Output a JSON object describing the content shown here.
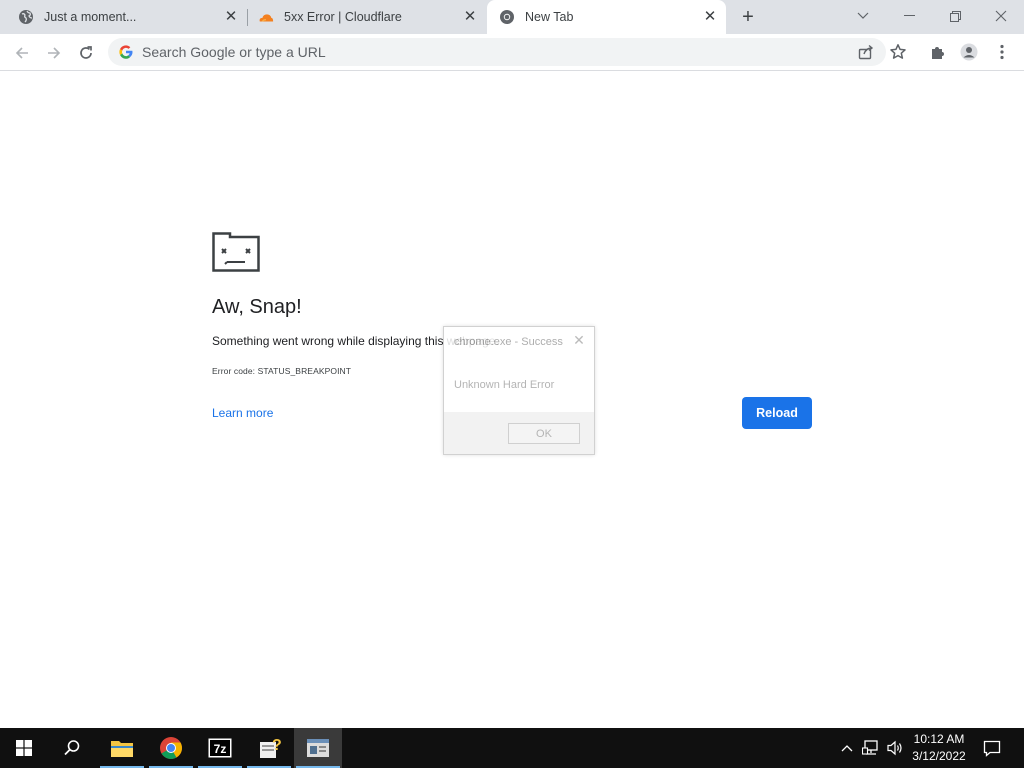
{
  "browser": {
    "tabs": [
      {
        "title": "Just a moment...",
        "favicon": "globe-icon",
        "active": false
      },
      {
        "title": "5xx Error | Cloudflare",
        "favicon": "cloudflare-icon",
        "active": false
      },
      {
        "title": "New Tab",
        "favicon": "chrome-icon",
        "active": true
      }
    ],
    "new_tab_symbol": "+",
    "omnibox_placeholder": "Search Google or type a URL"
  },
  "page": {
    "heading": "Aw, Snap!",
    "message": "Something went wrong while displaying this webpage.",
    "error_code": "Error code: STATUS_BREAKPOINT",
    "learn_more": "Learn more",
    "reload_label": "Reload"
  },
  "dialog": {
    "title": "chrome.exe - Success",
    "body": "Unknown Hard Error",
    "ok_label": "OK"
  },
  "taskbar": {
    "apps": [
      "start-icon",
      "search-icon",
      "file-explorer-icon",
      "chrome-icon",
      "7zip-icon",
      "help-app-icon",
      "error-dialog-app-icon"
    ],
    "time": "10:12 AM",
    "date": "3/12/2022"
  },
  "colors": {
    "accent": "#1a73e8",
    "tabstrip": "#dee1e6",
    "taskbar": "#101010",
    "taskbar_active_underline": "#76b9ed"
  }
}
